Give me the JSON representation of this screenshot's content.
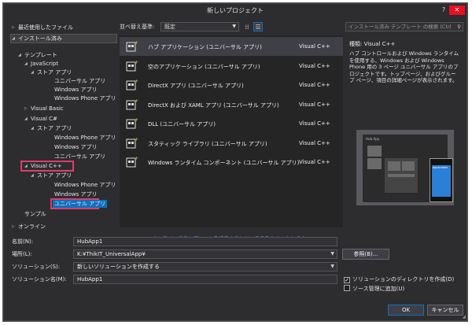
{
  "window": {
    "title": "新しいプロジェクト",
    "help_label": "?",
    "close_label": "✕"
  },
  "tree": {
    "recent": "最近使用したファイル",
    "installed": "インストール済み",
    "templates": "テンプレート",
    "javascript": "JavaScript",
    "js_store": "ストア アプリ",
    "js_universal": "ユニバーサル アプリ",
    "js_windows": "Windows アプリ",
    "js_phone": "Windows Phone アプリ",
    "visual_basic": "Visual Basic",
    "csharp": "Visual C#",
    "cs_store": "ストア アプリ",
    "cs_phone": "Windows Phone アプリ",
    "cs_windows": "Windows アプリ",
    "cs_universal": "ユニバーサル アプリ",
    "cpp": "Visual C++",
    "cpp_store": "ストア アプリ",
    "cpp_phone": "Windows Phone アプリ",
    "cpp_windows": "Windows アプリ",
    "cpp_universal": "ユニバーサル アプリ",
    "samples": "サンプル",
    "online": "オンライン"
  },
  "sort": {
    "label": "並べ替え基準:",
    "value": "既定"
  },
  "templates": [
    {
      "name": "ハブ アプリケーション (ユニバーサル アプリ)",
      "lang": "Visual C++",
      "icon": "hub-app-icon",
      "selected": true
    },
    {
      "name": "空のアプリケーション (ユニバーサル アプリ)",
      "lang": "Visual C++",
      "icon": "blank-app-icon",
      "selected": false
    },
    {
      "name": "DirectX アプリ (ユニバーサル アプリ)",
      "lang": "Visual C++",
      "icon": "directx-app-icon",
      "selected": false
    },
    {
      "name": "DirectX および XAML アプリ (ユニバーサル アプリ)",
      "lang": "Visual C++",
      "icon": "directx-xaml-app-icon",
      "selected": false
    },
    {
      "name": "DLL (ユニバーサル アプリ)",
      "lang": "Visual C++",
      "icon": "dll-icon",
      "selected": false
    },
    {
      "name": "スタティック ライブラリ (ユニバーサル アプリ)",
      "lang": "Visual C++",
      "icon": "static-library-icon",
      "selected": false
    },
    {
      "name": "Windows ランタイム コンポーネント (ユニバーサル アプリ)",
      "lang": "Visual C++",
      "icon": "winrt-component-icon",
      "selected": false
    }
  ],
  "online_link": "オンラインでテンプレートを検索するには、ここをクリックします。",
  "search": {
    "placeholder": "インストール済み テンプレート の検索 (Ctrl"
  },
  "details": {
    "type_line": "種類:  Visual C++",
    "description": "ハブ コントロールおよび Windows ランタイムを使用する、Windows および Windows Phone 用の 3 ページ ユニバーサル アプリのプロジェクトです。トップページ、およびグループ ページ、項目の詳細ページが表示されます。",
    "preview_caption": "Hub App",
    "preview_phone": "application"
  },
  "form": {
    "name_label": "名前(N):",
    "name_value": "HubApp1",
    "location_label": "場所(L):",
    "location_value": "K:¥ThikIT_UniversalApp¥",
    "solution_label": "ソリューション(S):",
    "solution_value": "新しいソリューションを作成する",
    "solution_name_label": "ソリューション名(M):",
    "solution_name_value": "HubApp1",
    "browse_label": "参照(B)...",
    "create_dir_label": "ソリューションのディレクトリを作成(D)",
    "create_dir_checked": "✓",
    "scm_label": "ソース管理に追加(U)",
    "ok_label": "OK",
    "cancel_label": "キャンセル"
  },
  "colors": {
    "background": "#2d2d30",
    "list_bg": "#252526",
    "selection": "#3f3f46",
    "highlight_box": "#e03c6b",
    "link": "#3399ff"
  }
}
